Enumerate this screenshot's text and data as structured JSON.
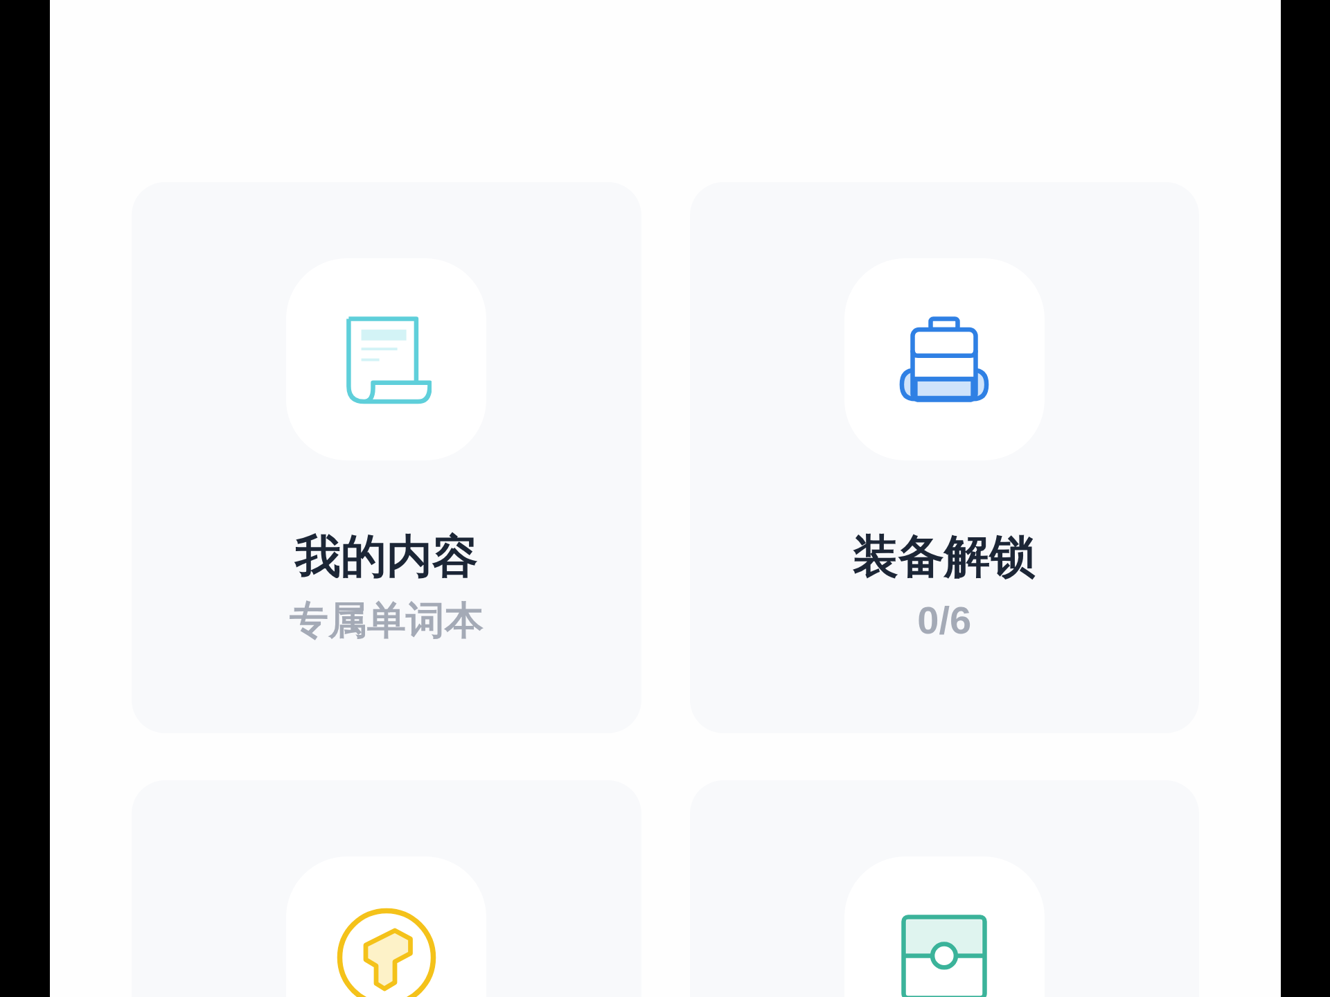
{
  "cards": [
    {
      "kind": "document",
      "title": "我的内容",
      "subtitle": "专属单词本"
    },
    {
      "kind": "backpack",
      "title": "装备解锁",
      "subtitle": "0/6"
    },
    {
      "kind": "coin"
    },
    {
      "kind": "box"
    }
  ]
}
